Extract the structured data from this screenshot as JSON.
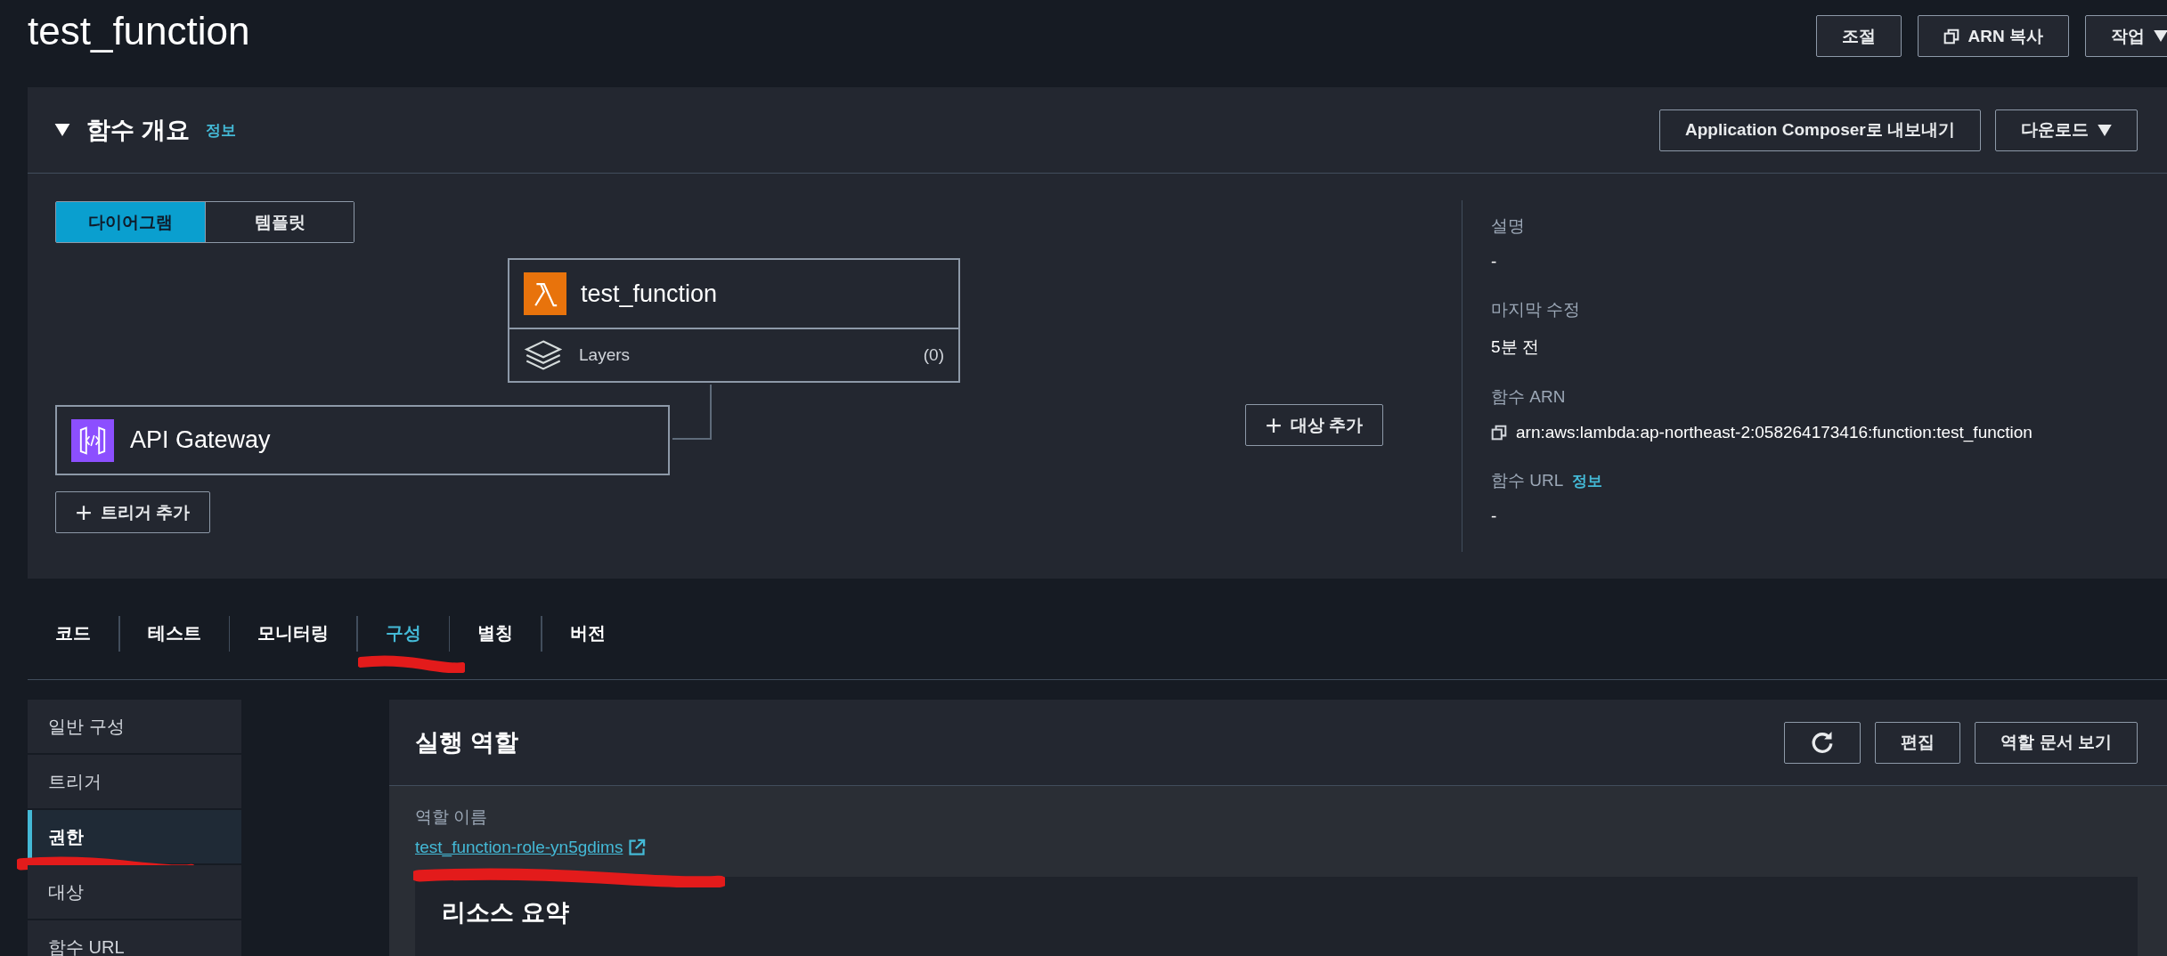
{
  "page": {
    "title": "test_function",
    "buttons": [
      {
        "label": "조절",
        "kind": "plain"
      },
      {
        "label": "ARN 복사",
        "kind": "copy"
      },
      {
        "label": "작업",
        "kind": "dropdown"
      }
    ]
  },
  "overview": {
    "title": "함수 개요",
    "info": "정보",
    "expanded": true,
    "buttons": [
      {
        "label": "Application Composer로 내보내기",
        "kind": "plain"
      },
      {
        "label": "다운로드",
        "kind": "dropdown"
      }
    ],
    "view_toggle": [
      {
        "label": "다이어그램",
        "selected": true
      },
      {
        "label": "템플릿",
        "selected": false
      }
    ],
    "function_node": {
      "name": "test_function",
      "layers_label": "Layers",
      "layers_count": "(0)"
    },
    "trigger_node": {
      "name": "API Gateway"
    },
    "add_trigger": "트리거 추가",
    "add_destination": "대상 추가",
    "details": [
      {
        "label": "설명",
        "value": "-",
        "kind": "text"
      },
      {
        "label": "마지막 수정",
        "value": "5분 전",
        "kind": "text"
      },
      {
        "label": "함수 ARN",
        "value": "arn:aws:lambda:ap-northeast-2:058264173416:function:test_function",
        "kind": "copy"
      },
      {
        "label": "함수 URL",
        "info": "정보",
        "value": "-",
        "kind": "text"
      }
    ]
  },
  "tabs": [
    {
      "label": "코드",
      "selected": false,
      "marked": false
    },
    {
      "label": "테스트",
      "selected": false,
      "marked": false
    },
    {
      "label": "모니터링",
      "selected": false,
      "marked": false
    },
    {
      "label": "구성",
      "selected": true,
      "marked": true
    },
    {
      "label": "별칭",
      "selected": false,
      "marked": false
    },
    {
      "label": "버전",
      "selected": false,
      "marked": false
    }
  ],
  "sidebar": {
    "items": [
      {
        "label": "일반 구성",
        "selected": false,
        "marked": false
      },
      {
        "label": "트리거",
        "selected": false,
        "marked": false
      },
      {
        "label": "권한",
        "selected": true,
        "marked": true
      },
      {
        "label": "대상",
        "selected": false,
        "marked": false
      },
      {
        "label": "함수 URL",
        "selected": false,
        "marked": false
      }
    ]
  },
  "role_panel": {
    "title": "실행 역할",
    "buttons": [
      {
        "kind": "refresh"
      },
      {
        "label": "편집",
        "kind": "plain"
      },
      {
        "label": "역할 문서 보기",
        "kind": "plain"
      }
    ],
    "role_name_label": "역할 이름",
    "role_name": "test_function-role-yn5gdims",
    "role_name_marked": true,
    "summary_title": "리소스 요약"
  }
}
